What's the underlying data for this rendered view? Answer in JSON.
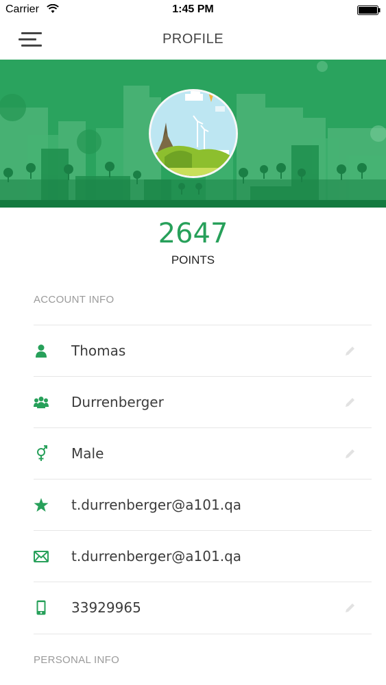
{
  "status_bar": {
    "carrier": "Carrier",
    "time": "1:45 PM"
  },
  "nav": {
    "title": "PROFILE"
  },
  "profile": {
    "points_value": "2647",
    "points_label": "POINTS"
  },
  "account_info": {
    "header": "ACCOUNT INFO",
    "rows": [
      {
        "icon": "person-icon",
        "value": "Thomas",
        "editable": true
      },
      {
        "icon": "group-icon",
        "value": "Durrenberger",
        "editable": true
      },
      {
        "icon": "gender-icon",
        "value": "Male",
        "editable": true
      },
      {
        "icon": "star-icon",
        "value": "t.durrenberger@a101.qa",
        "editable": false
      },
      {
        "icon": "envelope-icon",
        "value": "t.durrenberger@a101.qa",
        "editable": false
      },
      {
        "icon": "mobile-phone-icon",
        "value": "33929965",
        "editable": true
      }
    ]
  },
  "personal_info": {
    "header": "PERSONAL INFO"
  },
  "colors": {
    "accent": "#27a05a",
    "banner": "#2aa35e",
    "text": "#3c3c3c",
    "muted": "#9a9a9a"
  }
}
